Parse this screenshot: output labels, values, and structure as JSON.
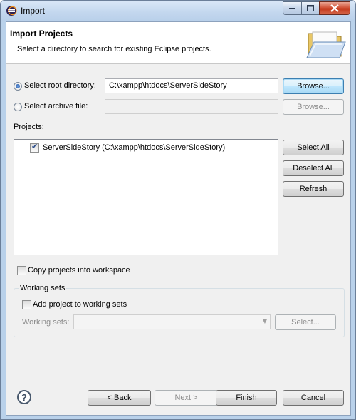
{
  "window": {
    "title": "Import"
  },
  "header": {
    "title": "Import Projects",
    "description": "Select a directory to search for existing Eclipse projects."
  },
  "source": {
    "root_radio_label": "Select root directory:",
    "root_value": "C:\\xampp\\htdocs\\ServerSideStory",
    "root_browse": "Browse...",
    "archive_radio_label": "Select archive file:",
    "archive_value": "",
    "archive_browse": "Browse..."
  },
  "projects": {
    "label": "Projects:",
    "items": [
      {
        "label": "ServerSideStory (C:\\xampp\\htdocs\\ServerSideStory)",
        "checked": true
      }
    ],
    "select_all": "Select All",
    "deselect_all": "Deselect All",
    "refresh": "Refresh"
  },
  "options": {
    "copy_label": "Copy projects into workspace"
  },
  "working_sets": {
    "group_label": "Working sets",
    "add_label": "Add project to working sets",
    "sets_label": "Working sets:",
    "select_button": "Select..."
  },
  "footer": {
    "help_icon": "?",
    "back": "< Back",
    "next": "Next >",
    "finish": "Finish",
    "cancel": "Cancel"
  },
  "icons": {
    "app": "eclipse-icon",
    "header": "folder-open-icon",
    "help": "help-icon"
  }
}
